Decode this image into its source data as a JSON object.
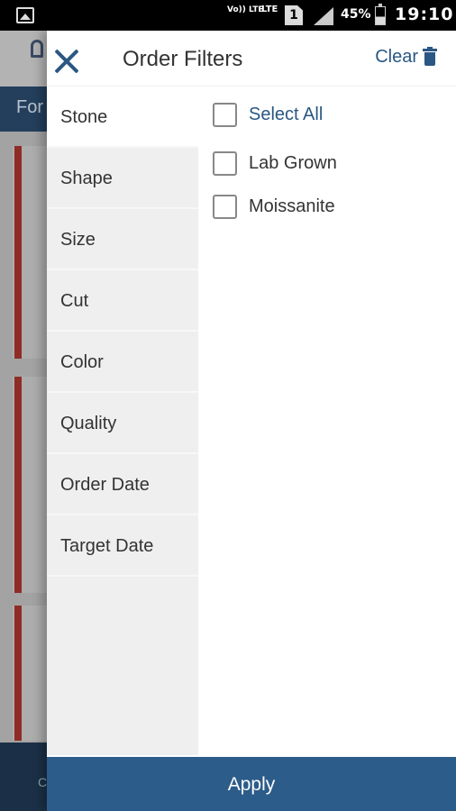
{
  "status_bar": {
    "volte": "Vo)) LTE",
    "network": "LTE",
    "sim": "1",
    "battery": "45%",
    "time": "19:10",
    "icons": [
      "image-icon",
      "volte-icon",
      "sim-icon",
      "signal-icon",
      "battery-icon"
    ]
  },
  "background_app": {
    "header_text": "For",
    "bottom_text": "C"
  },
  "drawer": {
    "title": "Order Filters",
    "clear_label": "Clear",
    "close_icon": "close-icon",
    "clear_icon": "trash-icon",
    "categories": [
      {
        "label": "Stone",
        "active": true
      },
      {
        "label": "Shape",
        "active": false
      },
      {
        "label": "Size",
        "active": false
      },
      {
        "label": "Cut",
        "active": false
      },
      {
        "label": "Color",
        "active": false
      },
      {
        "label": "Quality",
        "active": false
      },
      {
        "label": "Order Date",
        "active": false
      },
      {
        "label": "Target Date",
        "active": false
      }
    ],
    "select_all_label": "Select All",
    "options": [
      {
        "label": "Lab Grown",
        "checked": false
      },
      {
        "label": "Moissanite",
        "checked": false
      }
    ],
    "apply_label": "Apply"
  },
  "colors": {
    "accent": "#2a5783",
    "apply_button": "#2c5c89",
    "category_bg": "#efefef"
  }
}
